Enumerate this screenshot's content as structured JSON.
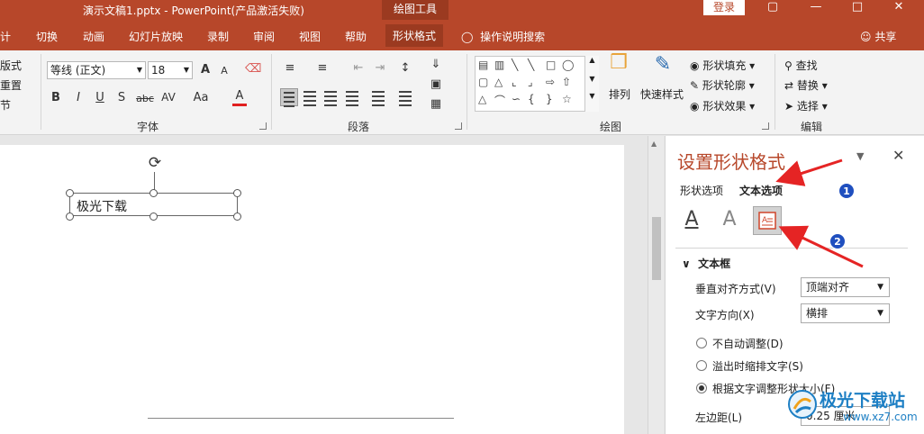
{
  "titlebar": {
    "document_title": "演示文稿1.pptx  -  PowerPoint(产品激活失败)",
    "context_label": "绘图工具",
    "login_label": "登录",
    "icons": [
      "ribbon-display-icon",
      "minimize-icon",
      "maximize-icon",
      "close-icon"
    ]
  },
  "tabs": [
    "计",
    "切换",
    "动画",
    "幻灯片放映",
    "录制",
    "审阅",
    "视图",
    "帮助",
    "形状格式"
  ],
  "active_tab": "形状格式",
  "tell_me": "操作说明搜索",
  "share": "共享",
  "ribbon": {
    "left_cut": [
      "版式",
      "重置",
      "节"
    ],
    "font_group": {
      "label": "字体",
      "font_name": "等线 (正文)",
      "font_size": "18",
      "grow": "A",
      "shrink": "A",
      "bold": "B",
      "italic": "I",
      "underline": "U",
      "shadow": "S",
      "strike": "abc",
      "spacing": "AV",
      "case": "Aa",
      "color": "A"
    },
    "paragraph_group": {
      "label": "段落"
    },
    "drawing_group": {
      "label": "绘图",
      "arrange": "排列",
      "quick_styles": "快速样式",
      "fill": "形状填充",
      "outline": "形状轮廓",
      "effects": "形状效果"
    },
    "editing_group": {
      "label": "编辑",
      "find": "查找",
      "replace": "替换",
      "select": "选择"
    }
  },
  "slide": {
    "textbox_text": "极光下载"
  },
  "format_pane": {
    "title": "设置形状格式",
    "tab_shape": "形状选项",
    "tab_text": "文本选项",
    "icon_fill_glyph": "A",
    "icon_outline_glyph": "A",
    "section": "文本框",
    "vertical_align_label": "垂直对齐方式(V)",
    "vertical_align_value": "顶端对齐",
    "text_direction_label": "文字方向(X)",
    "text_direction_value": "横排",
    "autofit_options": [
      {
        "label": "不自动调整(D)",
        "selected": false
      },
      {
        "label": "溢出时缩排文字(S)",
        "selected": false
      },
      {
        "label": "根据文字调整形状大小(F)",
        "selected": true
      }
    ],
    "left_margin_label": "左边距(L)",
    "left_margin_value": "0.25 厘米"
  },
  "annotations": {
    "badge1": "1",
    "badge2": "2",
    "arrow_color": "#e52424"
  },
  "watermark": {
    "name": "极光下载站",
    "url": "www.xz7.com"
  },
  "colors": {
    "brand": "#b7472a",
    "brand_dark": "#9b3a20",
    "badge": "#1f4fbf"
  }
}
